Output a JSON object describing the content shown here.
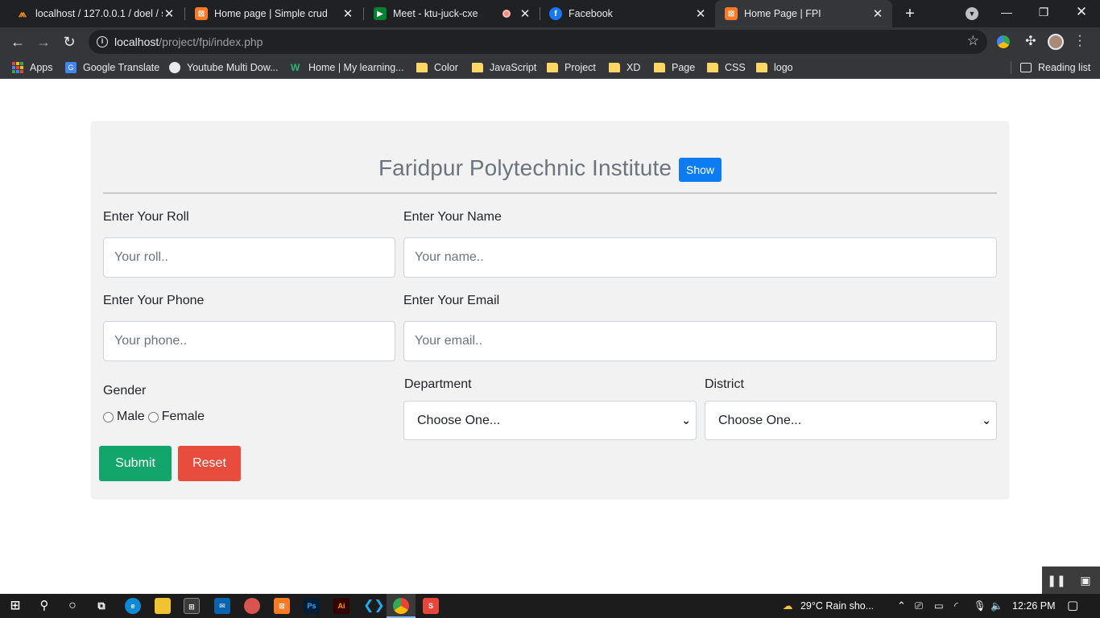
{
  "browser": {
    "tabs": [
      {
        "title": "localhost / 127.0.0.1 / doel / s",
        "favicon": "phpmyadmin-icon"
      },
      {
        "title": "Home page | Simple crud",
        "favicon": "xampp-icon"
      },
      {
        "title": "Meet - ktu-juck-cxe",
        "favicon": "google-meet-icon",
        "recording": true
      },
      {
        "title": "Facebook",
        "favicon": "facebook-icon"
      },
      {
        "title": "Home Page | FPI",
        "favicon": "xampp-icon",
        "active": true
      }
    ],
    "url_host": "localhost",
    "url_path": "/project/fpi/index.php",
    "bookmarks": [
      {
        "label": "Apps",
        "icon": "apps-grid-icon"
      },
      {
        "label": "Google Translate",
        "icon": "google-translate-icon"
      },
      {
        "label": "Youtube Multi Dow...",
        "icon": "globe-icon"
      },
      {
        "label": "Home | My learning...",
        "icon": "w-logo-icon"
      },
      {
        "label": "Color",
        "icon": "folder-icon"
      },
      {
        "label": "JavaScript",
        "icon": "folder-icon"
      },
      {
        "label": "Project",
        "icon": "folder-icon"
      },
      {
        "label": "XD",
        "icon": "folder-icon"
      },
      {
        "label": "Page",
        "icon": "folder-icon"
      },
      {
        "label": "CSS",
        "icon": "folder-icon"
      },
      {
        "label": "logo",
        "icon": "folder-icon"
      }
    ],
    "reading_list": "Reading list"
  },
  "form": {
    "title": "Faridpur Polytechnic Institute",
    "show_button": "Show",
    "roll_label": "Enter Your Roll",
    "roll_placeholder": "Your roll..",
    "name_label": "Enter Your Name",
    "name_placeholder": "Your name..",
    "phone_label": "Enter Your Phone",
    "phone_placeholder": "Your phone..",
    "email_label": "Enter Your Email",
    "email_placeholder": "Your email..",
    "gender_label": "Gender",
    "gender_options": [
      "Male",
      "Female"
    ],
    "department_label": "Department",
    "department_selected": "Choose One...",
    "district_label": "District",
    "district_selected": "Choose One...",
    "submit_button": "Submit",
    "reset_button": "Reset"
  },
  "taskbar": {
    "weather": "29°C  Rain sho...",
    "time": "12:26 PM"
  },
  "colors": {
    "show_button": "#0d7cf2",
    "submit_button": "#12a66b",
    "reset_button": "#e74c3c",
    "chrome_dark": "#202124",
    "chrome_toolbar": "#35363a"
  }
}
